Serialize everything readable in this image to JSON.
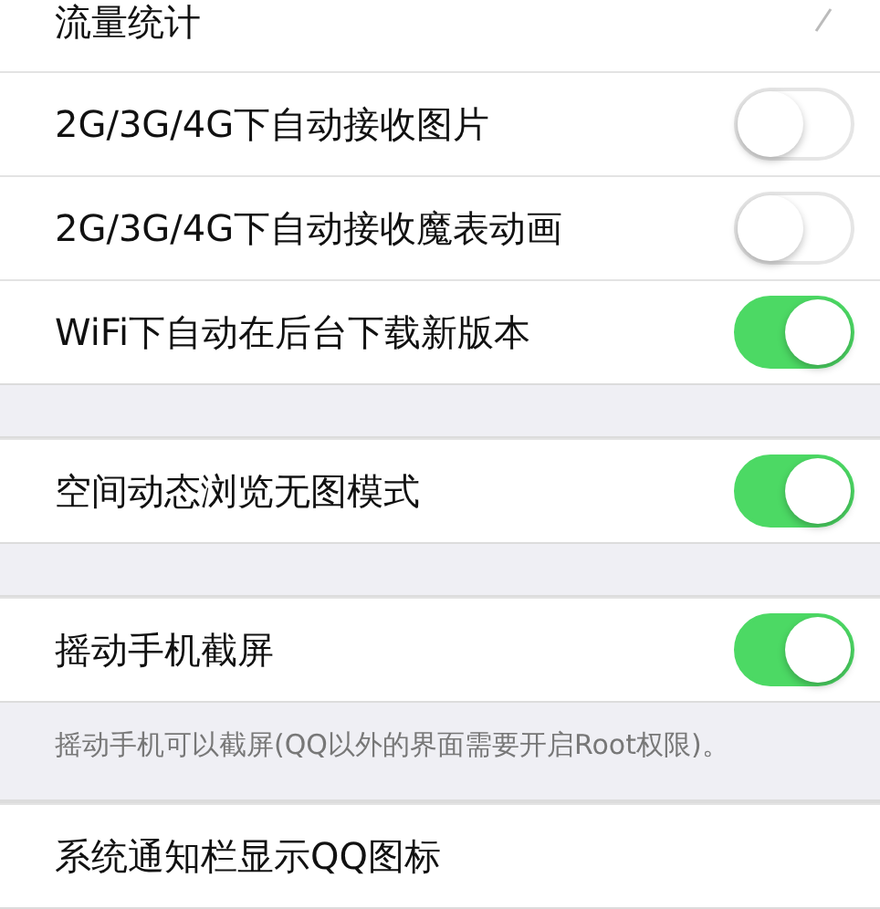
{
  "groups": [
    {
      "rows": [
        {
          "kind": "link",
          "label": "流量统计"
        },
        {
          "kind": "toggle",
          "label": "2G/3G/4G下自动接收图片",
          "on": false
        },
        {
          "kind": "toggle",
          "label": "2G/3G/4G下自动接收魔表动画",
          "on": false
        },
        {
          "kind": "toggle",
          "label": "WiFi下自动在后台下载新版本",
          "on": true
        }
      ]
    },
    {
      "rows": [
        {
          "kind": "toggle",
          "label": "空间动态浏览无图模式",
          "on": true
        }
      ]
    },
    {
      "rows": [
        {
          "kind": "toggle",
          "label": "摇动手机截屏",
          "on": true
        }
      ],
      "note": "摇动手机可以截屏(QQ以外的界面需要开启Root权限)。"
    },
    {
      "rows": [
        {
          "kind": "plain",
          "label": "系统通知栏显示QQ图标"
        }
      ]
    }
  ]
}
